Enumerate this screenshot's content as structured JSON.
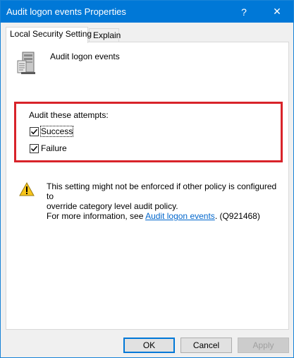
{
  "window": {
    "title": "Audit logon events Properties",
    "help_label": "?",
    "close_label": "✕"
  },
  "tabs": [
    {
      "label": "Local Security Setting",
      "active": true
    },
    {
      "label": "Explain",
      "active": false
    }
  ],
  "policy": {
    "name": "Audit logon events"
  },
  "audit": {
    "label": "Audit these attempts:",
    "success": {
      "label": "Success",
      "checked": true
    },
    "failure": {
      "label": "Failure",
      "checked": true
    }
  },
  "warning": {
    "line1": "This setting might not be enforced if other policy is configured to",
    "line2": "override category level audit policy.",
    "line3_prefix": "For more information, see ",
    "link_text": "Audit logon events",
    "line3_suffix": ". (Q921468)"
  },
  "buttons": {
    "ok": "OK",
    "cancel": "Cancel",
    "apply": "Apply"
  },
  "colors": {
    "titlebar": "#0078d7",
    "highlight_border": "#d8232a",
    "link": "#0066cc"
  }
}
